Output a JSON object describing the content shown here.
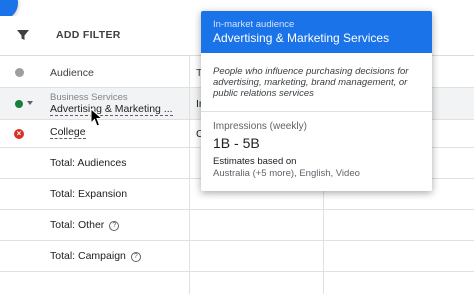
{
  "toolbar": {
    "add_filter_label": "ADD FILTER",
    "filter_icon": "filter-icon"
  },
  "table": {
    "headers": {
      "audience": "Audience",
      "col2_partial": "T"
    },
    "rows": [
      {
        "status": "enabled",
        "category": "Business Services",
        "name": "Advertising & Marketing ...",
        "col2_partial": "In"
      },
      {
        "status": "excluded",
        "name": "College",
        "col2_partial": "C"
      }
    ],
    "totals": [
      {
        "label": "Total: Audiences",
        "help": false
      },
      {
        "label": "Total: Expansion",
        "help": false
      },
      {
        "label": "Total: Other",
        "help": true
      },
      {
        "label": "Total: Campaign",
        "help": true
      }
    ]
  },
  "tooltip": {
    "subtitle": "In-market audience",
    "title": "Advertising & Marketing Services",
    "description": "People who influence purchasing decisions for advertising, marketing, brand management, or public relations services",
    "impressions_label": "Impressions (weekly)",
    "impressions_value": "1B - 5B",
    "estimates_label": "Estimates based on",
    "estimates_value": "Australia (+5 more), English, Video"
  },
  "colors": {
    "accent": "#1a73e8",
    "status_enabled": "#188038",
    "status_excluded": "#d93025"
  }
}
